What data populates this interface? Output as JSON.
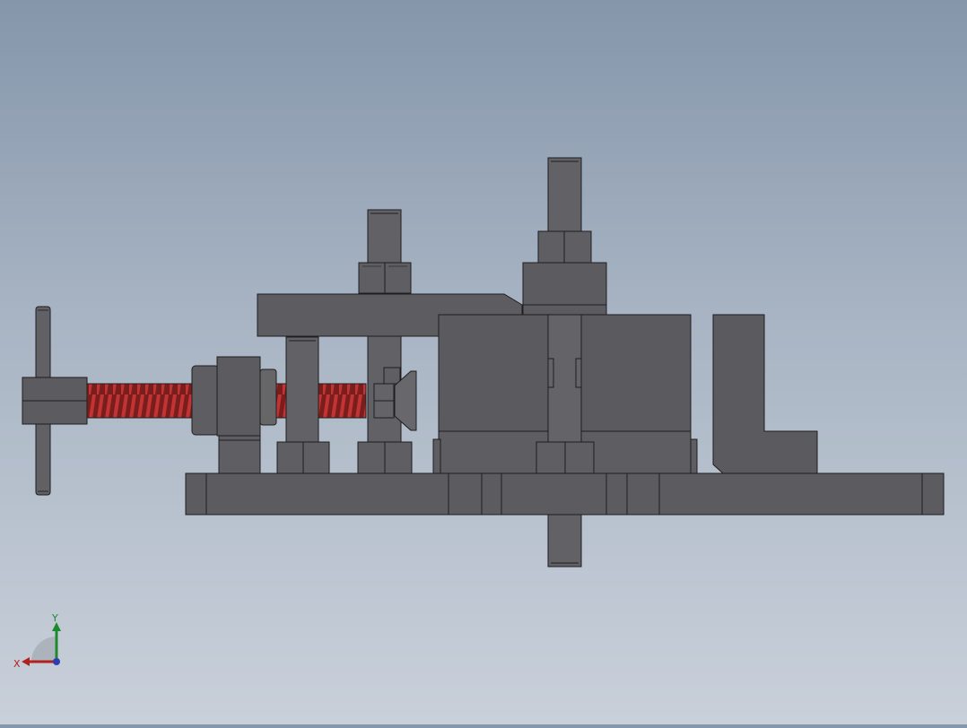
{
  "viewport": {
    "background_top": "#8596ab",
    "background_bottom": "#c9d0da",
    "part_fill": "#5f5f63",
    "part_fill_light": "#6a6a6f",
    "edge_color": "#1e1e20",
    "thread_color": "#b02a2a"
  },
  "triad": {
    "x_label": "X",
    "y_label": "Y",
    "x_color": "#b3211d",
    "y_color": "#1f8a2b",
    "z_color": "#2b3fb3"
  }
}
